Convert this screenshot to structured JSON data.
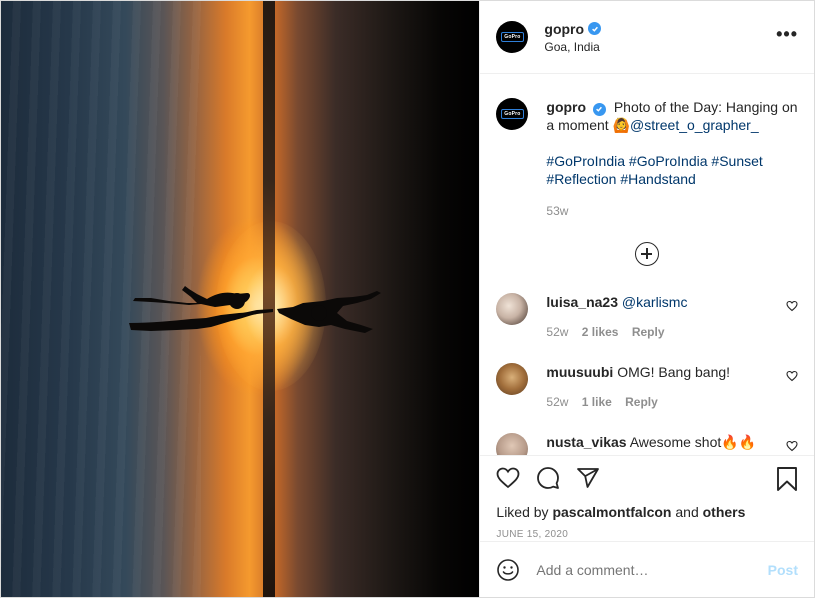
{
  "header": {
    "username": "gopro",
    "location": "Goa, India",
    "avatar_logo_text": "GoPro",
    "more_label": "•••"
  },
  "caption": {
    "username": "gopro",
    "text": "Photo of the Day: Hanging on a moment",
    "emoji": "🙆",
    "mention": "@street_o_grapher_",
    "hashtags": [
      "#GoProIndia",
      "#GoProIndia",
      "#Sunset",
      "#Reflection",
      "#Handstand"
    ],
    "time": "53w"
  },
  "comments": [
    {
      "username": "luisa_na23",
      "text": "@karlismc",
      "time": "52w",
      "likes": "2 likes",
      "reply": "Reply",
      "avatar_color": "#c8b3a5"
    },
    {
      "username": "muusuubi",
      "text": "OMG! Bang bang!",
      "time": "52w",
      "likes": "1 like",
      "reply": "Reply",
      "avatar_color": "#a26f3c"
    },
    {
      "username": "nusta_vikas",
      "text": "Awesome shot🔥🔥",
      "avatar_color": "#b79b8a"
    }
  ],
  "actions": {
    "liked_prefix": "Liked by",
    "liked_user": "pascalmontfalcon",
    "liked_and": "and",
    "liked_others": "others",
    "date": "June 15, 2020"
  },
  "add_comment": {
    "placeholder": "Add a comment…",
    "post_label": "Post"
  },
  "colors": {
    "verified": "#3897f0",
    "link": "#00376b",
    "muted": "#8e8e8e",
    "post_disabled": "#b2dffc"
  }
}
